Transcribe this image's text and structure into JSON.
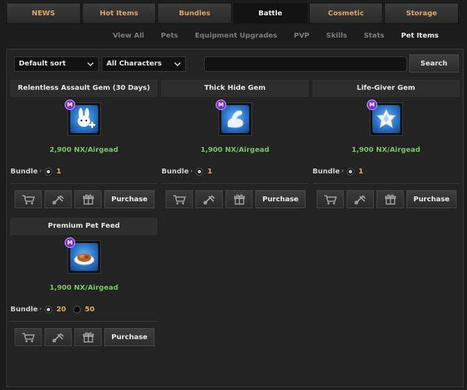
{
  "top_tabs": [
    {
      "label": "NEWS"
    },
    {
      "label": "Hot Items"
    },
    {
      "label": "Bundles"
    },
    {
      "label": "Battle"
    },
    {
      "label": "Cosmetic"
    },
    {
      "label": "Storage"
    }
  ],
  "active_top_tab": "Battle",
  "sub_tabs": [
    {
      "label": "View All"
    },
    {
      "label": "Pets"
    },
    {
      "label": "Equipment Upgrades"
    },
    {
      "label": "PVP"
    },
    {
      "label": "Skills"
    },
    {
      "label": "Stats"
    },
    {
      "label": "Pet Items"
    }
  ],
  "active_sub_tab": "Pet Items",
  "filters": {
    "sort_value": "Default sort",
    "character_value": "All Characters",
    "search_value": "",
    "search_button": "Search"
  },
  "actions": {
    "cart_icon": "cart-icon",
    "wishlist_icon": "wishlist-icon",
    "gift_icon": "gift-icon",
    "purchase_label": "Purchase"
  },
  "bundle_label": "Bundle",
  "items": [
    {
      "name": "Relentless Assault Gem (30 Days)",
      "price": "2,900 NX/Airgead",
      "icon": "rabbit-plus-gem-icon",
      "badge": "M",
      "bundle_options": [
        "1"
      ]
    },
    {
      "name": "Thick Hide Gem",
      "price": "1,900 NX/Airgead",
      "icon": "flexed-arm-gem-icon",
      "badge": "M",
      "bundle_options": [
        "1"
      ]
    },
    {
      "name": "Life-Giver Gem",
      "price": "1,900 NX/Airgead",
      "icon": "crystal-gem-icon",
      "badge": "M",
      "bundle_options": [
        "1"
      ]
    },
    {
      "name": "Premium Pet Feed",
      "price": "1,900 NX/Airgead",
      "icon": "pet-feed-icon",
      "badge": "M",
      "bundle_options": [
        "20",
        "50"
      ]
    }
  ],
  "colors": {
    "tab_text": "#e6a55a",
    "price_text": "#7cc466",
    "badge_purple": "#7a2ad0",
    "icon_blue": "#2a73c8"
  }
}
